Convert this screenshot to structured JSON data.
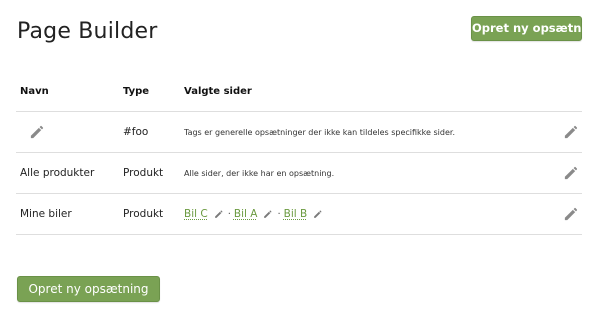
{
  "header": {
    "title": "Page Builder",
    "create_button_label": "Opret ny opsætning"
  },
  "table": {
    "columns": [
      "Navn",
      "Type",
      "Valgte sider"
    ],
    "rows": [
      {
        "name": "",
        "type": "#foo",
        "pages_text": "Tags er generelle opsætninger der ikke kan tildeles specifikke sider."
      },
      {
        "name": "Alle produkter",
        "type": "Produkt",
        "pages_text": "Alle sider, der ikke har en opsætning."
      },
      {
        "name": "Mine biler",
        "type": "Produkt",
        "pages": [
          "Bil C",
          "Bil A",
          "Bil B"
        ],
        "separator": "·"
      }
    ]
  },
  "footer": {
    "create_button_label": "Opret ny opsætning"
  },
  "colors": {
    "accent": "#7aa254",
    "link": "#6a9a3f",
    "divider": "#dedede"
  },
  "icons": {
    "edit": "pencil-icon"
  }
}
